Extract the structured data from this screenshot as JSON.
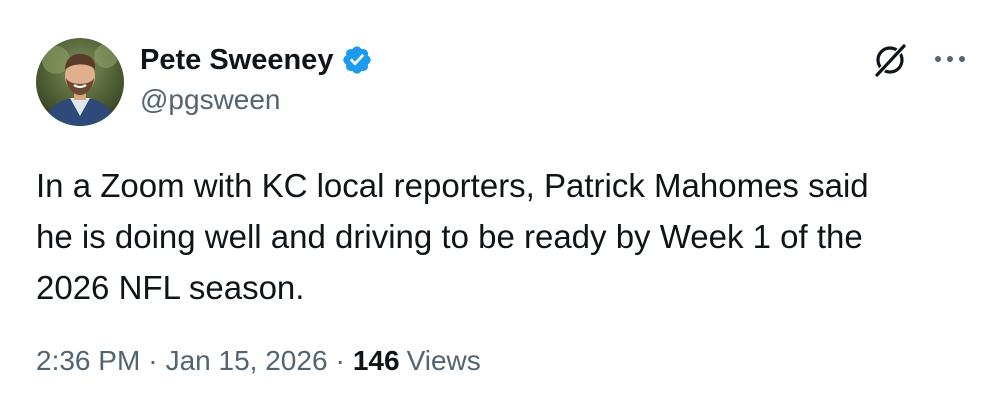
{
  "author": {
    "display_name": "Pete Sweeney",
    "handle": "@pgsween",
    "verified_icon": "verified-badge-icon",
    "avatar_icon": "avatar"
  },
  "actions": {
    "grok_icon": "grok-icon",
    "more_icon": "more-options-icon"
  },
  "tweet": {
    "text": "In a Zoom with KC local reporters, Patrick Mahomes said\nhe is doing well and driving to be ready by Week 1 of the\n2026 NFL season."
  },
  "meta": {
    "time": "2:36 PM",
    "separator": "·",
    "date": "Jan 15, 2026",
    "views_count": "146",
    "views_label": "Views"
  },
  "colors": {
    "text_primary": "#0f1419",
    "text_secondary": "#536471",
    "verified_blue": "#1d9bf0",
    "background": "#ffffff"
  }
}
